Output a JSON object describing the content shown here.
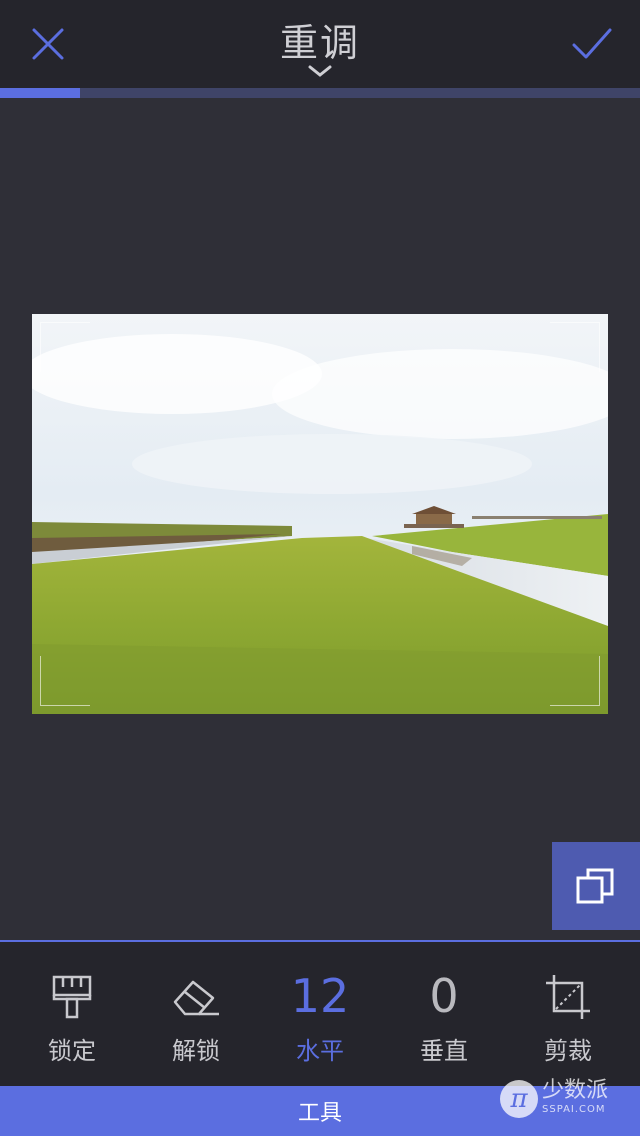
{
  "header": {
    "title": "重调",
    "close_icon": "close-icon",
    "confirm_icon": "checkmark-icon"
  },
  "progress": {
    "fraction": 0.125
  },
  "colors": {
    "accent": "#5b6ee0",
    "background": "#2f2f37",
    "bar": "#25252c"
  },
  "tools": [
    {
      "id": "lock",
      "label": "锁定",
      "icon": "brush-icon"
    },
    {
      "id": "unlock",
      "label": "解锁",
      "icon": "eraser-icon"
    },
    {
      "id": "horizontal",
      "label": "水平",
      "value": "12",
      "active": true
    },
    {
      "id": "vertical",
      "label": "垂直",
      "value": "0"
    },
    {
      "id": "crop",
      "label": "剪裁",
      "icon": "crop-icon"
    }
  ],
  "bottom_tab": {
    "label": "工具"
  },
  "watermark": {
    "brand": "少数派",
    "domain": "SSPAI.COM",
    "logo_letter": "π"
  }
}
